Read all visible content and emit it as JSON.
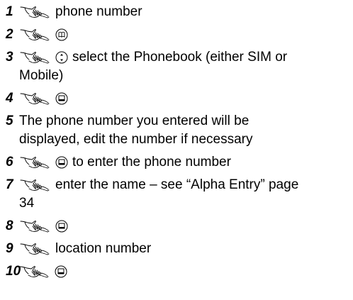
{
  "steps": [
    {
      "number": "1",
      "segments": [
        {
          "kind": "icon",
          "icon": "press-hand-icon"
        },
        {
          "kind": "text",
          "text": "phone number"
        }
      ]
    },
    {
      "number": "2",
      "segments": [
        {
          "kind": "icon",
          "icon": "press-hand-icon"
        },
        {
          "kind": "icon",
          "icon": "phonebook-key-icon"
        }
      ]
    },
    {
      "number": "3",
      "segments": [
        {
          "kind": "icon",
          "icon": "press-hand-icon"
        },
        {
          "kind": "icon",
          "icon": "navigation-key-icon"
        },
        {
          "kind": "text",
          "text": "select the Phonebook (either SIM or"
        }
      ],
      "continuation": "Mobile)"
    },
    {
      "number": "4",
      "segments": [
        {
          "kind": "icon",
          "icon": "press-hand-icon"
        },
        {
          "kind": "icon",
          "icon": "select-key-icon"
        }
      ]
    },
    {
      "number": "5",
      "segments": [
        {
          "kind": "text",
          "text": "The phone number you entered will be"
        }
      ],
      "continuation": "displayed, edit the number if necessary"
    },
    {
      "number": "6",
      "segments": [
        {
          "kind": "icon",
          "icon": "press-hand-icon"
        },
        {
          "kind": "icon",
          "icon": "select-key-icon"
        },
        {
          "kind": "text",
          "text": "to enter the phone number"
        }
      ]
    },
    {
      "number": "7",
      "segments": [
        {
          "kind": "icon",
          "icon": "press-hand-icon"
        },
        {
          "kind": "text",
          "text": "enter the name – see “Alpha Entry” page"
        }
      ],
      "continuation": "34"
    },
    {
      "number": "8",
      "segments": [
        {
          "kind": "icon",
          "icon": "press-hand-icon"
        },
        {
          "kind": "icon",
          "icon": "select-key-icon"
        }
      ]
    },
    {
      "number": "9",
      "segments": [
        {
          "kind": "icon",
          "icon": "press-hand-icon"
        },
        {
          "kind": "text",
          "text": "location number"
        }
      ]
    },
    {
      "number": "10",
      "segments": [
        {
          "kind": "icon",
          "icon": "press-hand-icon"
        },
        {
          "kind": "icon",
          "icon": "select-key-icon"
        }
      ]
    }
  ]
}
